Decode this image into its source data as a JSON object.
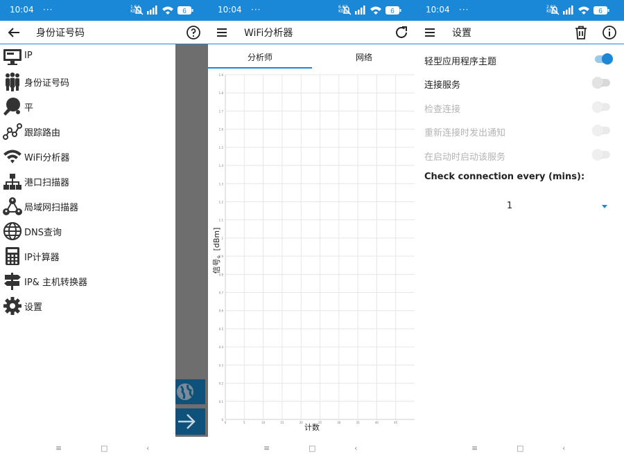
{
  "status": {
    "time": "10:04",
    "dots": "···",
    "screens": [
      {
        "net_speed": "1.54",
        "net_unit": "KB/s",
        "battery": "6"
      },
      {
        "net_speed": "6.37",
        "net_unit": "KB/s",
        "battery": "6"
      },
      {
        "net_speed": "2.22",
        "net_unit": "KB/s",
        "battery": "6"
      }
    ]
  },
  "colors": {
    "accent": "#1a88d6",
    "scrim": "#6e6e6e",
    "fab": "#0e527c"
  },
  "screen1": {
    "title": "身份证号码",
    "back_icon": "arrow-left-icon",
    "help_icon": "help-circle-icon",
    "menu": [
      {
        "label": "IP",
        "icon": "monitor-icon"
      },
      {
        "label": "身份证号码",
        "icon": "people-icon"
      },
      {
        "label": "平",
        "icon": "ping-paddle-icon"
      },
      {
        "label": "跟踪路由",
        "icon": "route-icon"
      },
      {
        "label": "WiFi分析器",
        "icon": "wifi-icon"
      },
      {
        "label": "港口扫描器",
        "icon": "network-icon"
      },
      {
        "label": "局域网扫描器",
        "icon": "lan-icon"
      },
      {
        "label": "DNS查询",
        "icon": "globe-icon"
      },
      {
        "label": "IP计算器",
        "icon": "calculator-icon"
      },
      {
        "label": "IP& 主机转换器",
        "icon": "signpost-icon"
      },
      {
        "label": "设置",
        "icon": "gear-icon"
      }
    ],
    "fab_icons": [
      "globe-icon",
      "arrow-right-icon"
    ]
  },
  "screen2": {
    "title": "WiFi分析器",
    "menu_icon": "hamburger-icon",
    "refresh_icon": "refresh-icon",
    "tabs": [
      {
        "label": "分析师",
        "active": true
      },
      {
        "label": "网络",
        "active": false
      }
    ]
  },
  "chart_data": {
    "type": "line",
    "xlabel": "计数",
    "ylabel": "信号。[dBm]",
    "xlim": [
      0,
      50
    ],
    "ylim": [
      0,
      1.9
    ],
    "x_ticks": [
      0,
      5,
      10,
      15,
      20,
      25,
      30,
      35,
      40,
      45
    ],
    "y_ticks": [
      0,
      0.1,
      0.2,
      0.3,
      0.4,
      0.5,
      0.6,
      0.7,
      0.8,
      0.9,
      1,
      1.1,
      1.2,
      1.3,
      1.4,
      1.5,
      1.6,
      1.7,
      1.8,
      1.9
    ],
    "grid": true,
    "series": []
  },
  "screen3": {
    "title": "设置",
    "menu_icon": "hamburger-icon",
    "delete_icon": "trash-icon",
    "info_icon": "info-icon",
    "rows": [
      {
        "label": "轻型应用程序主题",
        "enabled": true,
        "on": true
      },
      {
        "label": "连接服务",
        "enabled": true,
        "on": false
      },
      {
        "label": "检查连接",
        "enabled": false,
        "on": false
      },
      {
        "label": "重新连接时发出通知",
        "enabled": false,
        "on": false
      },
      {
        "label": "在启动时启动该服务",
        "enabled": false,
        "on": false
      }
    ],
    "check_title": "Check connection every (mins):",
    "interval_value": "1"
  },
  "navbar": {
    "recents": "≡",
    "home": "□",
    "back": "‹"
  }
}
